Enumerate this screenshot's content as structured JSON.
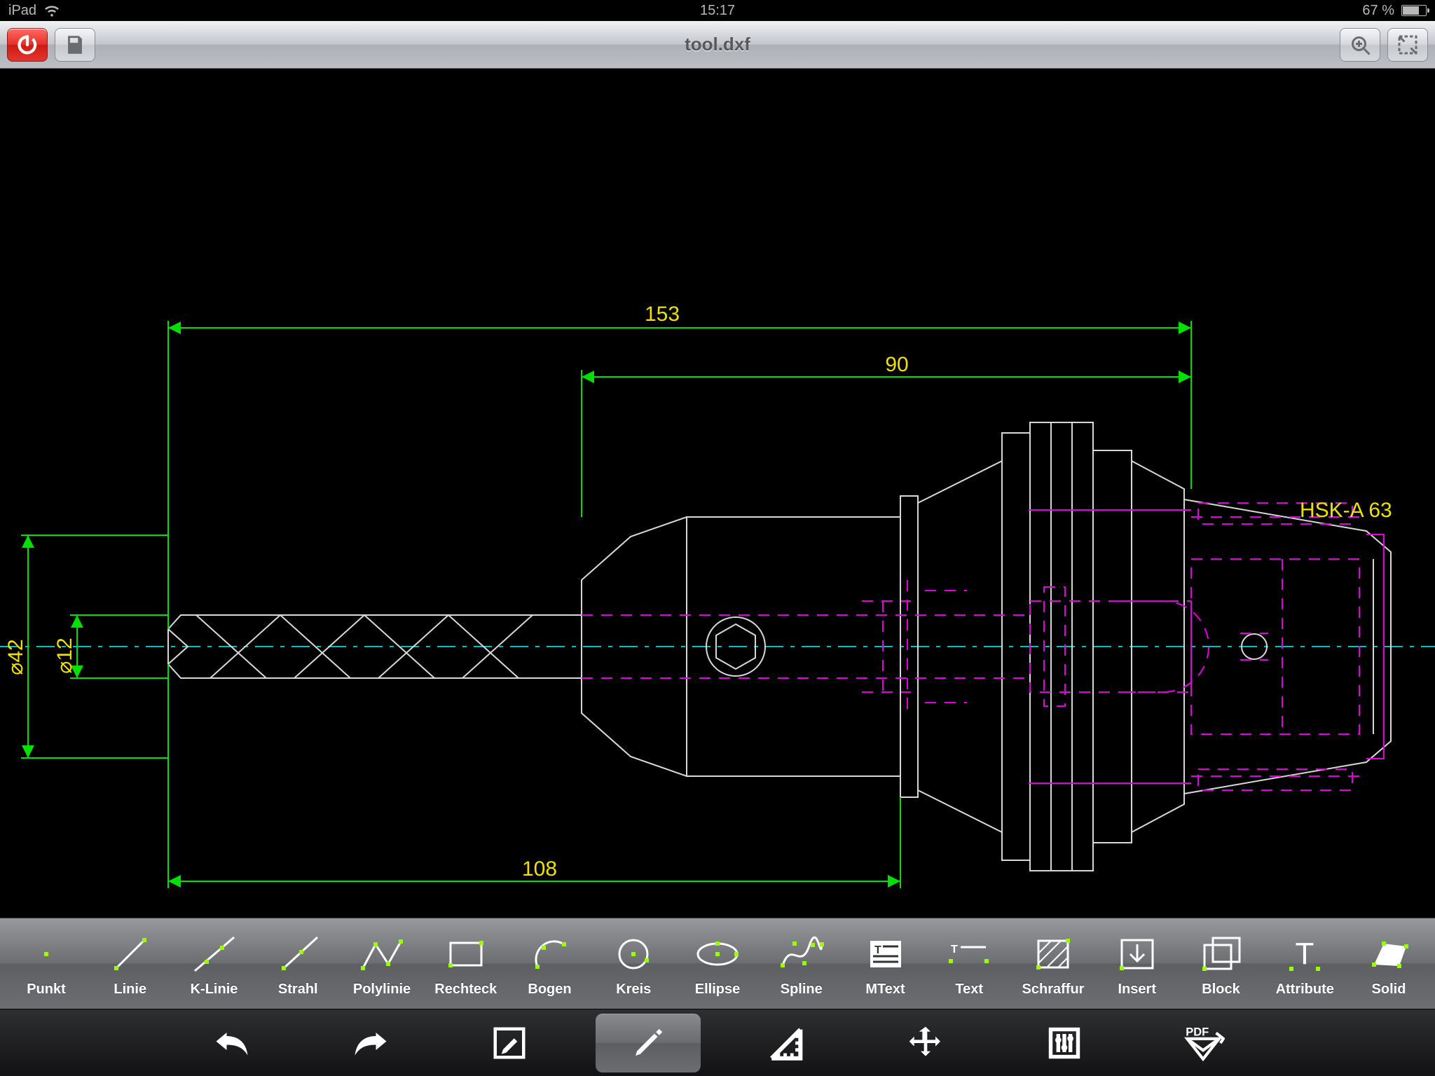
{
  "status": {
    "device": "iPad",
    "time": "15:17",
    "battery_text": "67 %"
  },
  "topbar": {
    "title": "tool.dxf"
  },
  "drawing": {
    "dims": {
      "d153": "153",
      "d90": "90",
      "d108": "108"
    },
    "diam": {
      "d42": "⌀42",
      "d12": "⌀12"
    },
    "label_hsk": "HSK-A 63"
  },
  "draw_tools": [
    "Punkt",
    "Linie",
    "K-Linie",
    "Strahl",
    "Polylinie",
    "Rechteck",
    "Bogen",
    "Kreis",
    "Ellipse",
    "Spline",
    "MText",
    "Text",
    "Schraffur",
    "Insert",
    "Block",
    "Attribute",
    "Solid"
  ],
  "colors": {
    "dim": "#00e000",
    "dimtext": "#f0e000",
    "hidden": "#e000e0",
    "center": "#00c0c0",
    "outline": "#d8d8d8",
    "anno": "#f0e000"
  }
}
